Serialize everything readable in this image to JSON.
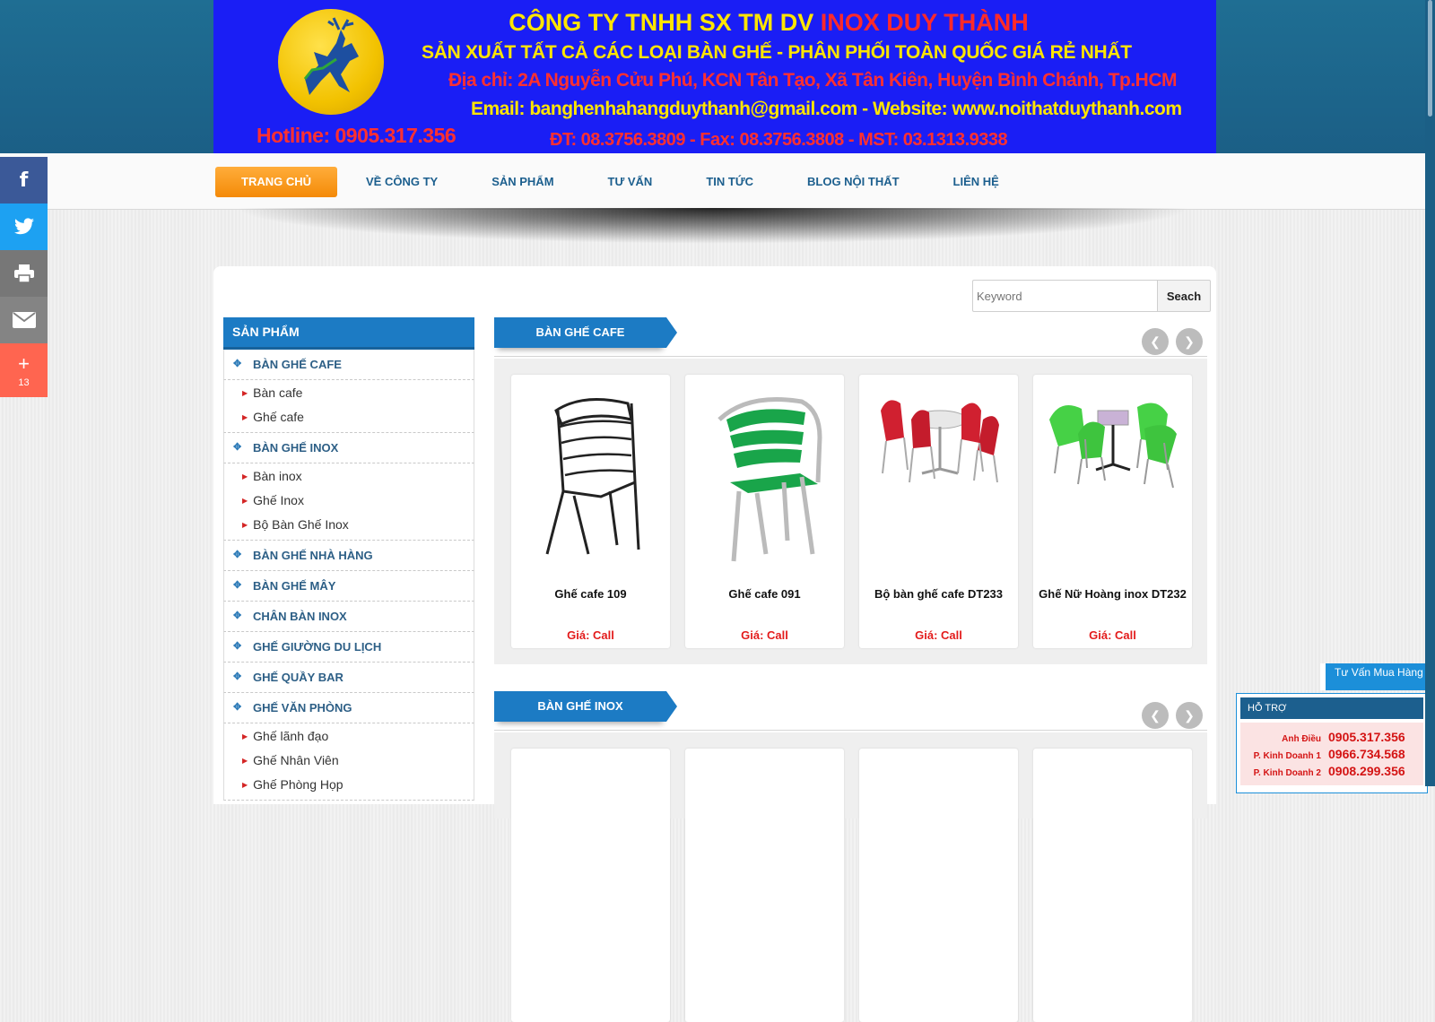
{
  "banner": {
    "company_prefix": "CÔNG TY TNHH SX TM DV",
    "company_name": "INOX DUY THÀNH",
    "tagline": "SẢN XUẤT TẤT CẢ CÁC LOẠI BÀN GHẾ - PHÂN PHỐI TOÀN QUỐC GIÁ RẺ NHẤT",
    "address": "Địa chỉ: 2A Nguyễn Cửu Phú, KCN Tân Tạo, Xã Tân Kiên, Huyện Bình Chánh, Tp.HCM",
    "email_web": "Email: banghenhahangduythanh@gmail.com - Website: www.noithatduythanh.com",
    "hotline": "Hotline: 0905.317.356",
    "contact": "ĐT: 08.3756.3809 - Fax: 08.3756.3808 - MST: 03.1313.9338"
  },
  "nav": {
    "items": [
      "TRANG CHỦ",
      "VỀ CÔNG TY",
      "SẢN PHẨM",
      "TƯ VẤN",
      "TIN TỨC",
      "BLOG NỘI THẤT",
      "LIÊN HỆ"
    ]
  },
  "search": {
    "placeholder": "Keyword",
    "button": "Seach"
  },
  "sidebar": {
    "heading": "SẢN PHẨM",
    "cat1": "BÀN GHẾ CAFE",
    "cat1_subs": [
      "Bàn cafe",
      "Ghế cafe"
    ],
    "cat2": "BÀN GHẾ INOX",
    "cat2_subs": [
      "Bàn inox",
      "Ghế Inox",
      "Bộ Bàn Ghế Inox"
    ],
    "cat3": "BÀN GHẾ NHÀ HÀNG",
    "cat4": "BÀN GHẾ MÂY",
    "cat5": "CHÂN BÀN INOX",
    "cat6": "GHẾ GIƯỜNG DU LỊCH",
    "cat7": "GHẾ QUẦY BAR",
    "cat8": "GHẾ VĂN PHÒNG",
    "cat8_subs": [
      "Ghế lãnh đạo",
      "Ghế Nhân Viên",
      "Ghế Phòng Họp"
    ]
  },
  "sections": [
    {
      "title": "BÀN GHẾ CAFE",
      "products": [
        {
          "name": "Ghế cafe 109",
          "price": "Giá: Call"
        },
        {
          "name": "Ghế cafe 091",
          "price": "Giá: Call"
        },
        {
          "name": "Bộ bàn ghế cafe DT233",
          "price": "Giá: Call"
        },
        {
          "name": "Ghế Nữ Hoàng inox DT232",
          "price": "Giá: Call"
        }
      ]
    },
    {
      "title": "BÀN GHẾ INOX"
    }
  ],
  "social": {
    "share_count": "13"
  },
  "support": {
    "tab": "Tư Vấn Mua Hàng",
    "heading": "HỖ TRỢ",
    "contacts": [
      {
        "label": "Anh Điều",
        "phone": "0905.317.356"
      },
      {
        "label": "P. Kinh Doanh 1",
        "phone": "0966.734.568"
      },
      {
        "label": "P. Kinh Doanh 2",
        "phone": "0908.299.356"
      }
    ]
  },
  "colors": {
    "accent_blue": "#1c7bc4",
    "nav_active": "#f48a08",
    "price_red": "#e31c1c",
    "banner_blue": "#1a1ef5"
  }
}
